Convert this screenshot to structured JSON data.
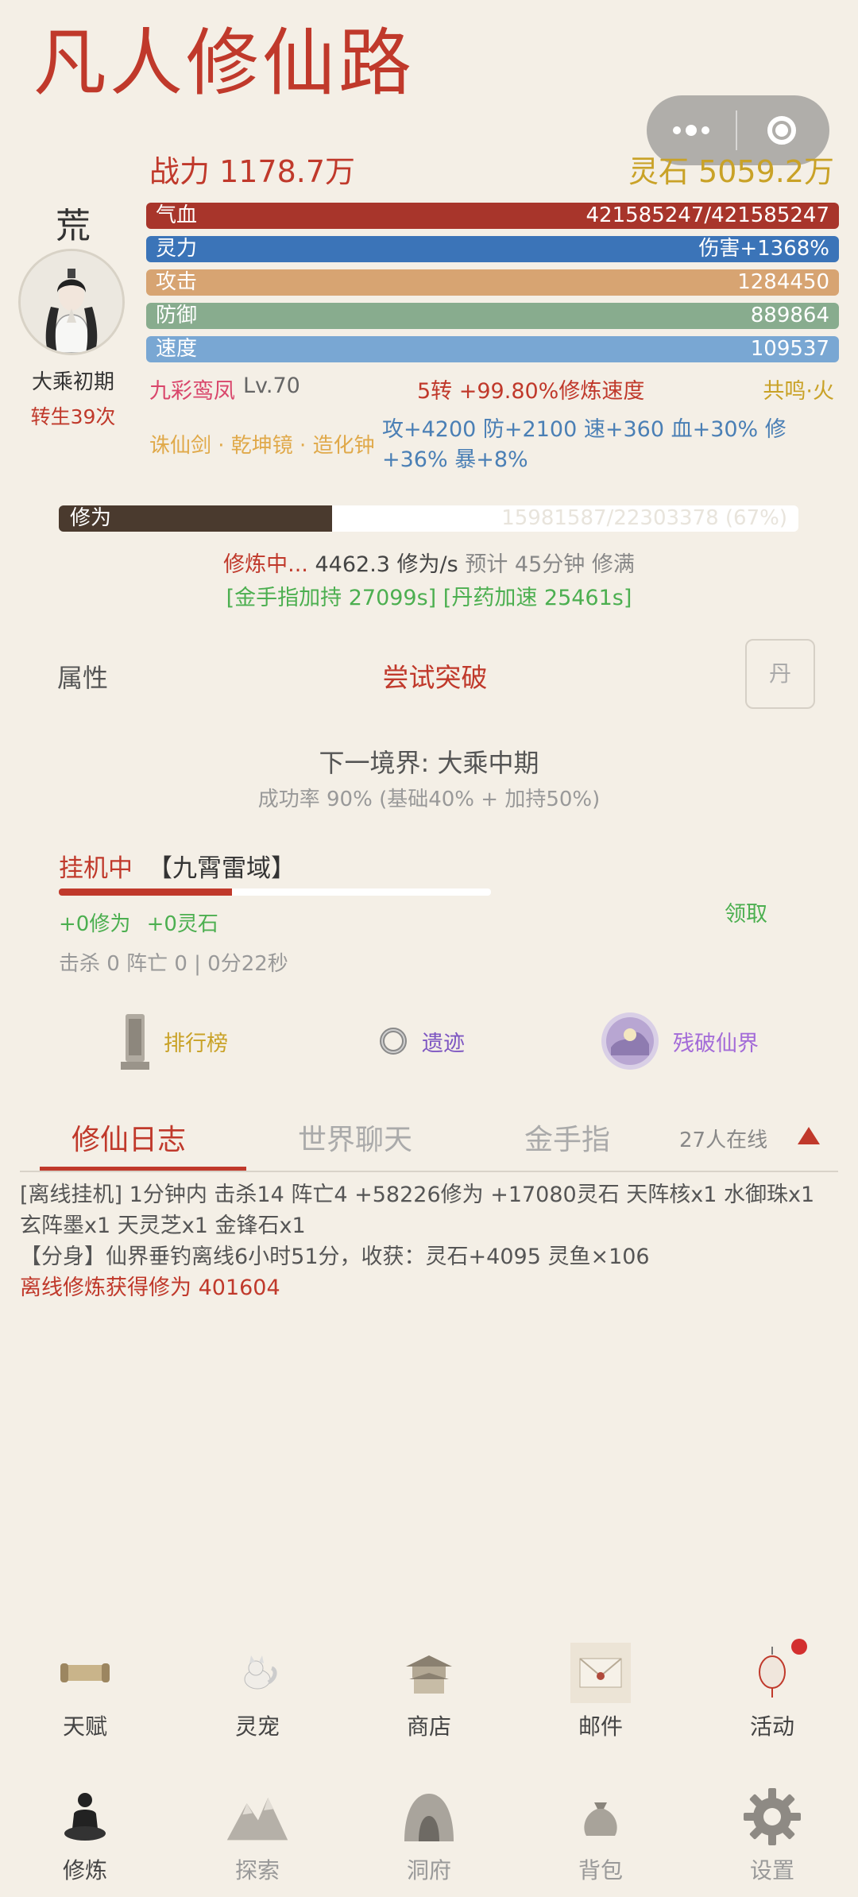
{
  "title": "凡人修仙路",
  "header": {
    "power": "战力 1178.7万",
    "spirit_stones": "灵石 5059.2万"
  },
  "character": {
    "realm_char": "荒",
    "realm_name": "大乘初期",
    "rebirth": "转生39次"
  },
  "stats": [
    {
      "label": "气血",
      "value": "421585247/421585247",
      "color": "#a8352b"
    },
    {
      "label": "灵力",
      "value": "伤害+1368%",
      "color": "#3b74b8"
    },
    {
      "label": "攻击",
      "value": "1284450",
      "color": "#d7a472"
    },
    {
      "label": "防御",
      "value": "889864",
      "color": "#88ac8e"
    },
    {
      "label": "速度",
      "value": "109537",
      "color": "#79a7d3"
    }
  ],
  "pet": {
    "name": "九彩鸾凤",
    "level": "Lv.70",
    "rebirth_bonus": "5转 +99.80%修炼速度",
    "resonance": "共鸣·火"
  },
  "treasures": "诛仙剑 · 乾坤镜 · 造化钟",
  "bonus": "攻+4200 防+2100 速+360 血+30% 修+36% 暴+8%",
  "cultivation": {
    "label": "修为",
    "value": "15981587/22303378 (67%)",
    "progress": 0.37,
    "status": "修炼中...",
    "rate": "4462.3 修为/s",
    "eta": "预计 45分钟 修满",
    "boosts": "[金手指加持 27099s] [丹药加速 25461s]"
  },
  "attributes": {
    "label": "属性",
    "breakthrough": "尝试突破",
    "pill": "丹",
    "next_realm": "下一境界: 大乘中期",
    "success_rate": "成功率 90% (基础40% + 加持50%)"
  },
  "idle": {
    "status": "挂机中",
    "place": "【九霄雷域】",
    "progress": 0.4,
    "gain": "+0修为 +0灵石",
    "claim": "领取",
    "stats": "击杀 0  阵亡 0 | 0分22秒"
  },
  "features": [
    {
      "label": "排行榜",
      "icon": "ranking-stele-icon",
      "color": "#c9a227"
    },
    {
      "label": "遗迹",
      "icon": "ring-icon",
      "color": "#7e57c2"
    },
    {
      "label": "残破仙界",
      "icon": "broken-realm-icon",
      "color": "#a36bd8"
    }
  ],
  "tabs": {
    "log": "修仙日志",
    "chat": "世界聊天",
    "finger": "金手指",
    "online": "27人在线"
  },
  "log": {
    "line1": "[离线挂机] 1分钟内 击杀14 阵亡4 +58226修为 +17080灵石 天阵核x1 水御珠x1 玄阵墨x1 天灵芝x1 金锋石x1",
    "line2": "【分身】仙界垂钓离线6小时51分，收获：灵石+4095 灵鱼×106",
    "line3": "离线修炼获得修为 401604"
  },
  "nav_top": [
    {
      "label": "天赋",
      "icon": "scroll-icon"
    },
    {
      "label": "灵宠",
      "icon": "fox-icon"
    },
    {
      "label": "商店",
      "icon": "pavilion-icon"
    },
    {
      "label": "邮件",
      "icon": "envelope-icon"
    },
    {
      "label": "活动",
      "icon": "lantern-icon"
    }
  ],
  "nav_bottom": [
    {
      "label": "修炼",
      "icon": "meditation-icon"
    },
    {
      "label": "探索",
      "icon": "mountain-icon"
    },
    {
      "label": "洞府",
      "icon": "cave-icon"
    },
    {
      "label": "背包",
      "icon": "bag-icon"
    },
    {
      "label": "设置",
      "icon": "gear-icon"
    }
  ]
}
